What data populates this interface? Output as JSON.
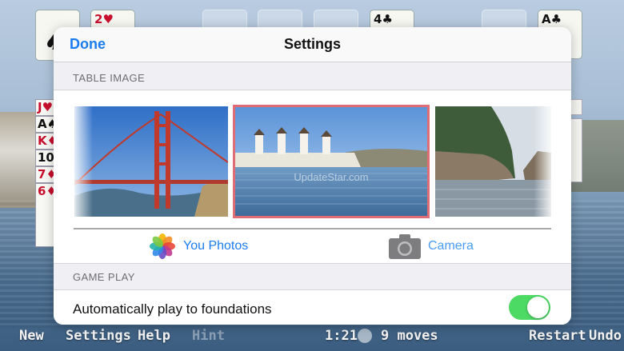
{
  "game": {
    "foundation_cards": [
      {
        "rank": "2",
        "suit": "♥",
        "color": "red"
      },
      {
        "rank": "4",
        "suit": "♣",
        "color": "black"
      },
      {
        "rank": "A",
        "suit": "♣",
        "color": "black"
      }
    ],
    "deck_suit": "♠",
    "tableau_column": [
      {
        "rank": "J",
        "suit": "♥",
        "color": "red"
      },
      {
        "rank": "A",
        "suit": "♠",
        "color": "black"
      },
      {
        "rank": "K",
        "suit": "♦",
        "color": "red"
      },
      {
        "rank": "10",
        "suit": "",
        "color": "black"
      },
      {
        "rank": "7",
        "suit": "♦",
        "color": "red"
      },
      {
        "rank": "6",
        "suit": "♦",
        "color": "red"
      }
    ],
    "toolbar": {
      "new": "New",
      "settings": "Settings",
      "help": "Help",
      "hint": "Hint",
      "time": "1:21",
      "moves": "9 moves",
      "restart": "Restart",
      "undo": "Undo"
    }
  },
  "settings": {
    "done_label": "Done",
    "title": "Settings",
    "table_image_header": "TABLE IMAGE",
    "images": [
      {
        "icon": "golden-gate-bridge-photo",
        "selected": false
      },
      {
        "icon": "mykonos-windmills-photo",
        "selected": true
      },
      {
        "icon": "rocky-coast-photo",
        "selected": false
      }
    ],
    "watermark": "UpdateStar.com",
    "photos_label": "You Photos",
    "camera_label": "Camera",
    "game_play_header": "GAME PLAY",
    "auto_play_label": "Automatically play to foundations",
    "auto_play_enabled": true
  },
  "colors": {
    "accent": "#1a7cf0",
    "selection_border": "#e06c74",
    "toggle_on": "#4cd964"
  }
}
